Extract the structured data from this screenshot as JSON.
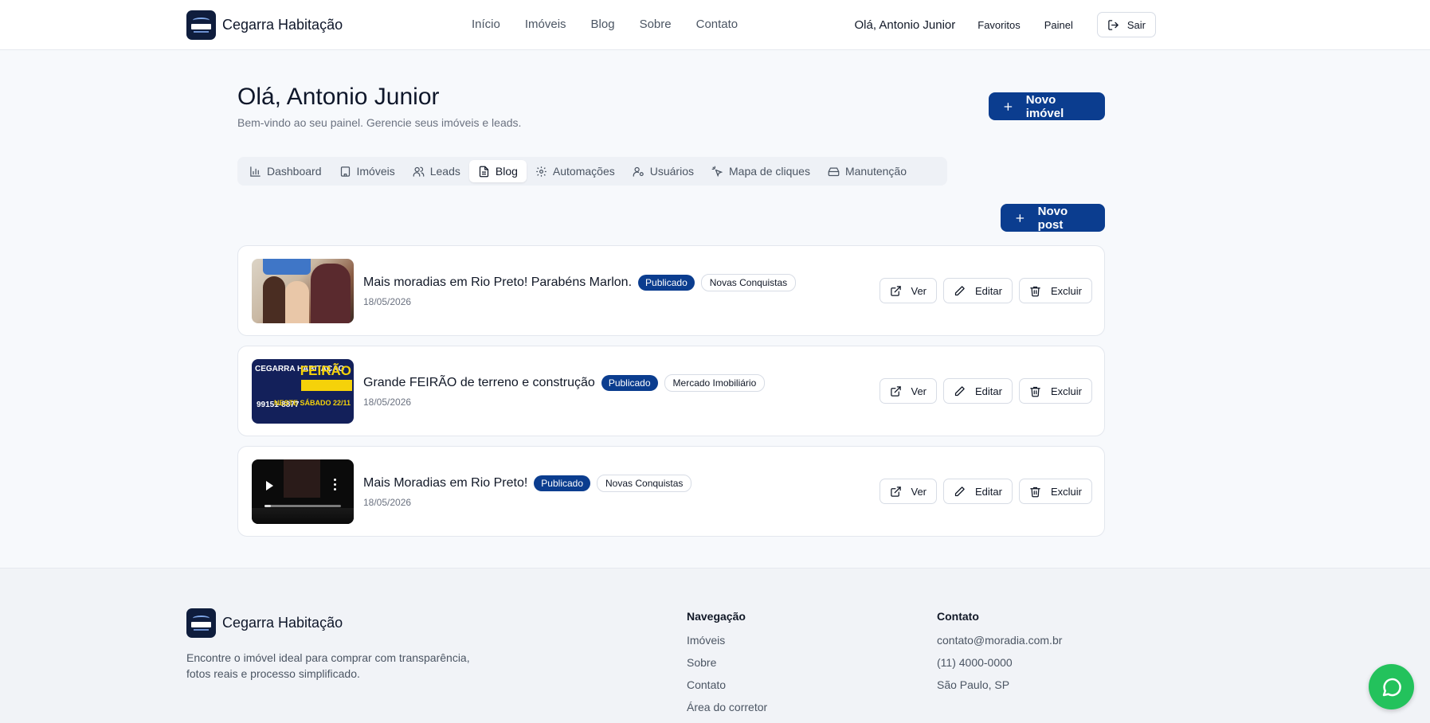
{
  "header": {
    "brand": "Cegarra Habitação",
    "nav": [
      "Início",
      "Imóveis",
      "Blog",
      "Sobre",
      "Contato"
    ],
    "greeting": "Olá, Antonio Junior",
    "favorites": "Favoritos",
    "panel": "Painel",
    "logout": "Sair"
  },
  "hero": {
    "title": "Olá, Antonio Junior",
    "subtitle": "Bem-vindo ao seu painel. Gerencie seus imóveis e leads.",
    "new_property": "Novo imóvel"
  },
  "tabs": [
    {
      "label": "Dashboard",
      "icon": "bar-chart-icon"
    },
    {
      "label": "Imóveis",
      "icon": "building-icon"
    },
    {
      "label": "Leads",
      "icon": "users-icon"
    },
    {
      "label": "Blog",
      "icon": "file-text-icon",
      "active": true
    },
    {
      "label": "Automações",
      "icon": "gear-icon"
    },
    {
      "label": "Usuários",
      "icon": "user-cog-icon"
    },
    {
      "label": "Mapa de cliques",
      "icon": "pointer-click-icon"
    },
    {
      "label": "Manutenção",
      "icon": "hard-drive-icon"
    }
  ],
  "blog": {
    "new_post": "Novo post",
    "posts": [
      {
        "title": "Mais moradias em Rio Preto! Parabéns Marlon.",
        "status": "Publicado",
        "category": "Novas Conquistas",
        "date": "18/05/2026"
      },
      {
        "title": "Grande FEIRÃO de terreno e construção",
        "status": "Publicado",
        "category": "Mercado Imobiliário",
        "date": "18/05/2026",
        "thumb_text": {
          "brand": "CEGARRA HABITAÇÃO",
          "feirao": "FEIRÃO",
          "phone": "99151-8877",
          "when": "NESTE SÁBADO 22/11"
        }
      },
      {
        "title": "Mais Moradias em Rio Preto!",
        "status": "Publicado",
        "category": "Novas Conquistas",
        "date": "18/05/2026"
      }
    ],
    "actions": {
      "view": "Ver",
      "edit": "Editar",
      "delete": "Excluir"
    }
  },
  "footer": {
    "brand": "Cegarra Habitação",
    "description": "Encontre o imóvel ideal para comprar com transparência, fotos reais e processo simplificado.",
    "nav_title": "Navegação",
    "nav_links": [
      "Imóveis",
      "Sobre",
      "Contato",
      "Área do corretor"
    ],
    "contact_title": "Contato",
    "contact": [
      "contato@moradia.com.br",
      "(11) 4000-0000",
      "São Paulo, SP"
    ]
  },
  "colors": {
    "primary": "#0b3d8f",
    "whatsapp": "#23c25c"
  }
}
